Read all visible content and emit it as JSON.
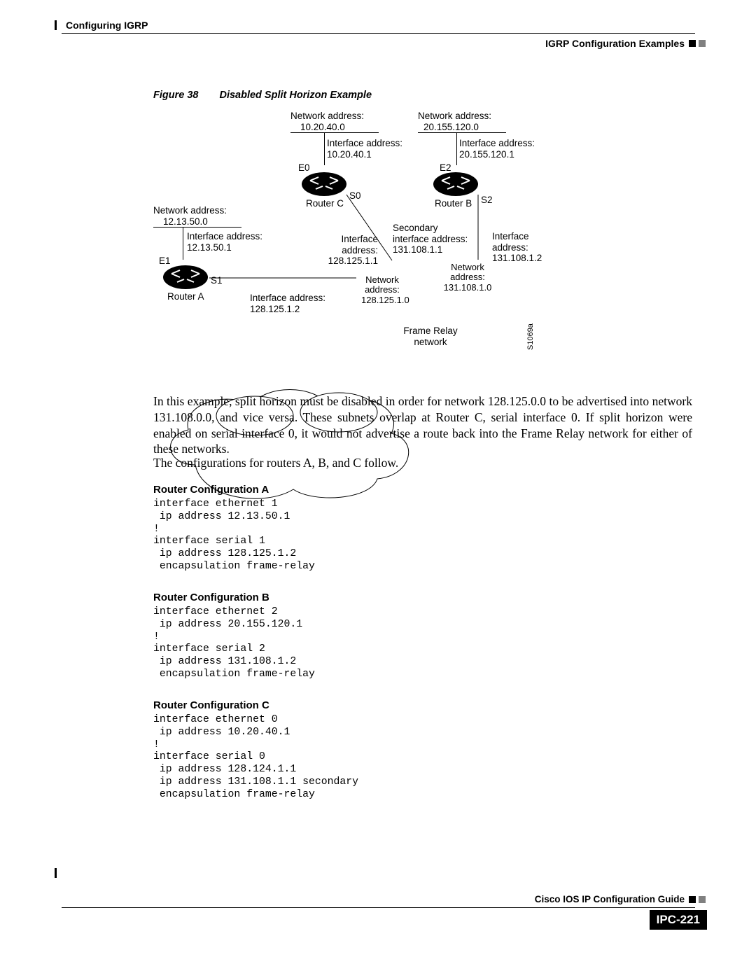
{
  "header": {
    "chapter": "Configuring IGRP",
    "section": "IGRP Configuration Examples"
  },
  "figure": {
    "label": "Figure 38",
    "title": "Disabled Split Horizon Example",
    "id": "S1069a",
    "labels": {
      "netC_hdr": "Network address:",
      "netC_val": "10.20.40.0",
      "netB_hdr": "Network address:",
      "netB_val": "20.155.120.0",
      "ifC_hdr": "Interface address:",
      "ifC_val": "10.20.40.1",
      "ifB_hdr": "Interface address:",
      "ifB_val": "20.155.120.1",
      "E0": "E0",
      "E2": "E2",
      "S0": "S0",
      "S2": "S2",
      "routerC": "Router C",
      "routerB": "Router B",
      "netA_hdr": "Network address:",
      "netA_val": "12.13.50.0",
      "ifA_hdr": "Interface address:",
      "ifA_val": "12.13.50.1",
      "E1": "E1",
      "S1": "S1",
      "routerA": "Router A",
      "ifS1_hdr": "Interface address:",
      "ifS1_val": "128.125.1.2",
      "ifS0_hdr": "Interface address:",
      "ifS0_val": "128.125.1.1",
      "sec_hdr": "Secondary",
      "sec_l2": "interface address:",
      "sec_val": "131.108.1.1",
      "ifS2_hdr": "Interface address:",
      "ifS2_val": "131.108.1.2",
      "cloudNet1_hdr": "Network",
      "cloudNet1_l2": "address:",
      "cloudNet1_val": "128.125.1.0",
      "cloudNet2_hdr": "Network",
      "cloudNet2_l2": "address:",
      "cloudNet2_val": "131.108.1.0",
      "fr1": "Frame Relay",
      "fr2": "network"
    }
  },
  "body": {
    "p1": "In this example, split horizon must be disabled in order for network 128.125.0.0 to be advertised into network 131.108.0.0, and vice versa. These subnets overlap at Router C, serial interface 0. If split horizon were enabled on serial interface 0, it would not advertise a route back into the Frame Relay network for either of these networks.",
    "p2": "The configurations for routers A, B, and C follow."
  },
  "configs": {
    "a_title": "Router Configuration A",
    "a_code": "interface ethernet 1\n ip address 12.13.50.1\n!\ninterface serial 1\n ip address 128.125.1.2\n encapsulation frame-relay",
    "b_title": "Router Configuration B",
    "b_code": "interface ethernet 2\n ip address 20.155.120.1\n!\ninterface serial 2\n ip address 131.108.1.2\n encapsulation frame-relay",
    "c_title": "Router Configuration C",
    "c_code": "interface ethernet 0\n ip address 10.20.40.1\n!\ninterface serial 0\n ip address 128.124.1.1\n ip address 131.108.1.1 secondary\n encapsulation frame-relay"
  },
  "footer": {
    "guide": "Cisco IOS IP Configuration Guide",
    "page": "IPC-221"
  }
}
